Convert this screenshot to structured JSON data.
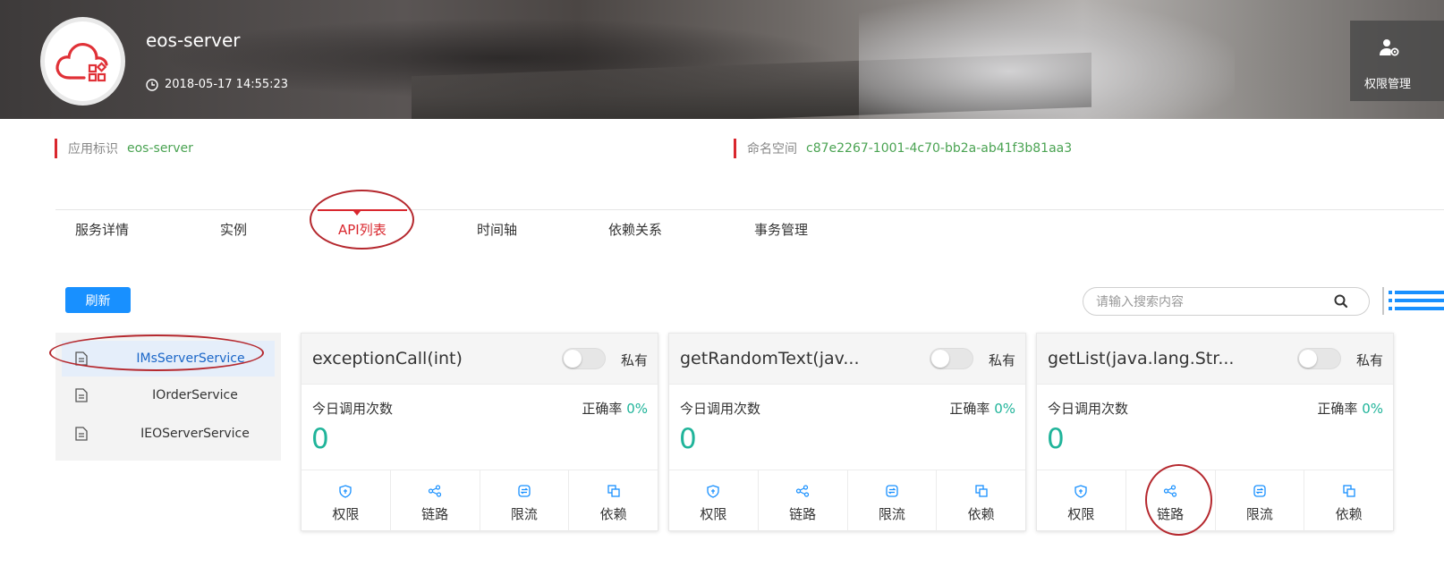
{
  "app": {
    "name": "eos-server",
    "timestamp": "2018-05-17 14:55:23",
    "permission_button": "权限管理"
  },
  "meta": {
    "app_id_label": "应用标识",
    "app_id_value": "eos-server",
    "namespace_label": "命名空间",
    "namespace_value": "c87e2267-1001-4c70-bb2a-ab41f3b81aa3"
  },
  "tabs": [
    {
      "label": "服务详情",
      "active": false
    },
    {
      "label": "实例",
      "active": false
    },
    {
      "label": "API列表",
      "active": true
    },
    {
      "label": "时间轴",
      "active": false
    },
    {
      "label": "依赖关系",
      "active": false
    },
    {
      "label": "事务管理",
      "active": false
    }
  ],
  "toolbar": {
    "refresh_label": "刷新",
    "search_placeholder": "请输入搜索内容"
  },
  "services": [
    {
      "name": "IMsServerService",
      "selected": true
    },
    {
      "name": "IOrderService",
      "selected": false
    },
    {
      "name": "IEOServerService",
      "selected": false
    }
  ],
  "cards": [
    {
      "name": "exceptionCall(int)",
      "private_label": "私有",
      "toggle_on": false,
      "calls_label": "今日调用次数",
      "calls_value": "0",
      "accuracy_label": "正确率",
      "accuracy_value": "0%",
      "actions": [
        "权限",
        "链路",
        "限流",
        "依赖"
      ]
    },
    {
      "name": "getRandomText(jav...",
      "private_label": "私有",
      "toggle_on": false,
      "calls_label": "今日调用次数",
      "calls_value": "0",
      "accuracy_label": "正确率",
      "accuracy_value": "0%",
      "actions": [
        "权限",
        "链路",
        "限流",
        "依赖"
      ]
    },
    {
      "name": "getList(java.lang.Str...",
      "private_label": "私有",
      "toggle_on": false,
      "calls_label": "今日调用次数",
      "calls_value": "0",
      "accuracy_label": "正确率",
      "accuracy_value": "0%",
      "actions": [
        "权限",
        "链路",
        "限流",
        "依赖"
      ]
    }
  ],
  "colors": {
    "accent_red": "#d9272e",
    "primary_blue": "#1890ff",
    "success_green": "#4aa352",
    "teal": "#20b49a"
  },
  "icons": [
    "cloud-logo-icon",
    "clock-icon",
    "user-settings-icon",
    "search-icon",
    "list-view-icon",
    "file-icon",
    "shield-icon",
    "share-nodes-icon",
    "exchange-icon",
    "copy-icon"
  ]
}
